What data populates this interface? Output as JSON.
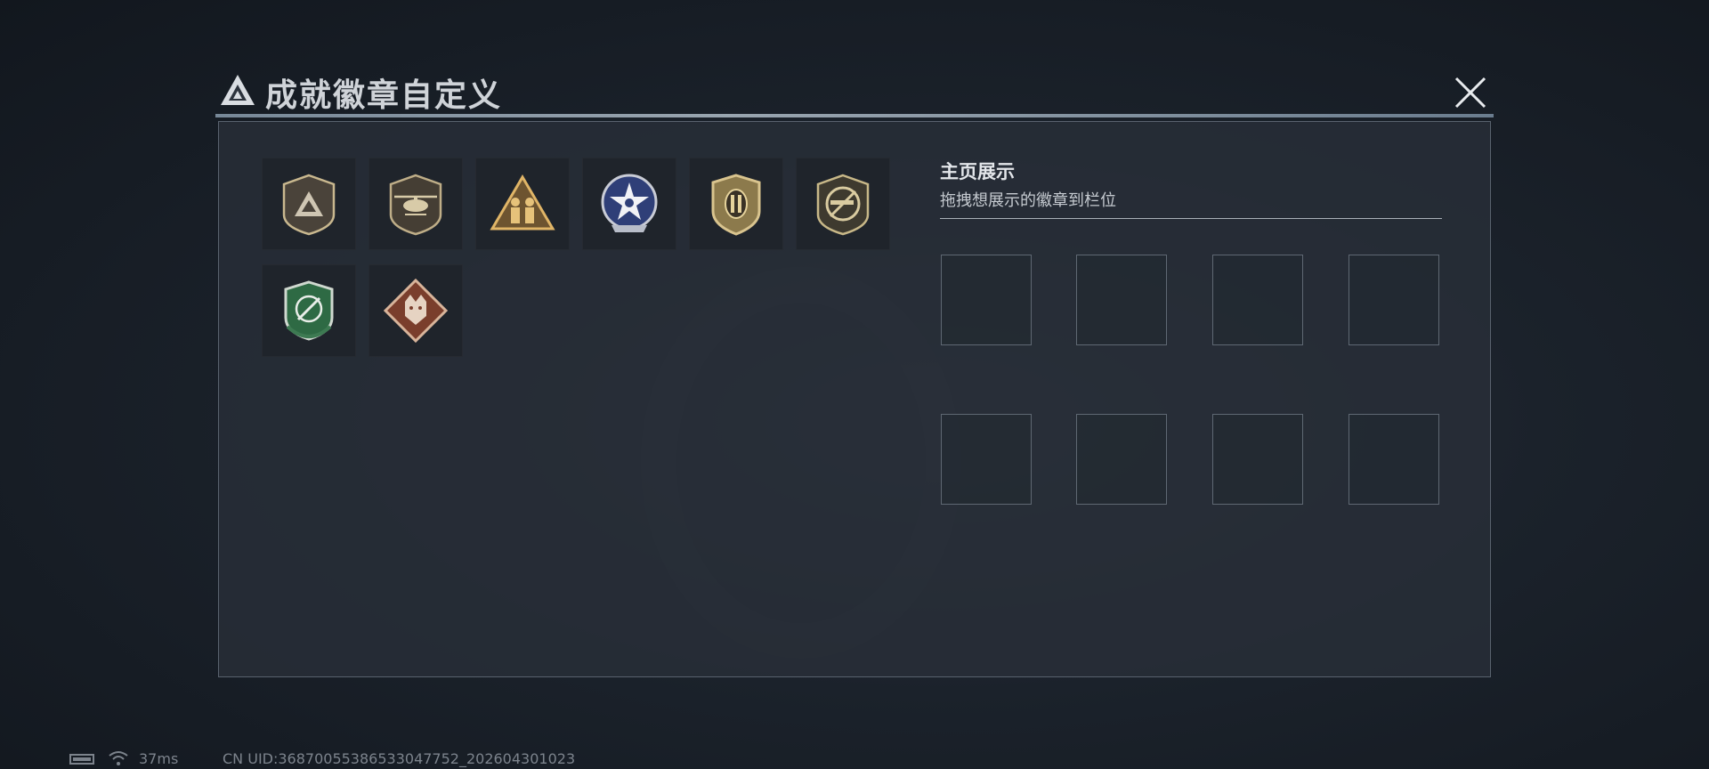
{
  "header": {
    "title": "成就徽章自定义",
    "logo_icon": "triangle-logo-icon",
    "close_icon": "close-icon"
  },
  "badges": [
    {
      "name": "triangle-emblem-badge",
      "color": "#8a7b63"
    },
    {
      "name": "helicopter-badge",
      "color": "#9b8a68"
    },
    {
      "name": "squad-triangle-badge",
      "color": "#b8924e"
    },
    {
      "name": "star-wreath-badge",
      "color": "#3c4f8c"
    },
    {
      "name": "shield-bars-badge",
      "color": "#a08e5c"
    },
    {
      "name": "no-rifle-badge",
      "color": "#8f8361"
    },
    {
      "name": "green-knife-shield-badge",
      "color": "#2f6b45"
    },
    {
      "name": "wolf-diamond-badge",
      "color": "#8c4a36"
    }
  ],
  "display": {
    "title": "主页展示",
    "hint": "拖拽想展示的徽章到栏位",
    "slot_count": 8
  },
  "status": {
    "battery_icon": "battery-icon",
    "wifi_icon": "wifi-icon",
    "ping": "37ms",
    "uid": "CN UID:36870055386533047752_202604301023"
  }
}
